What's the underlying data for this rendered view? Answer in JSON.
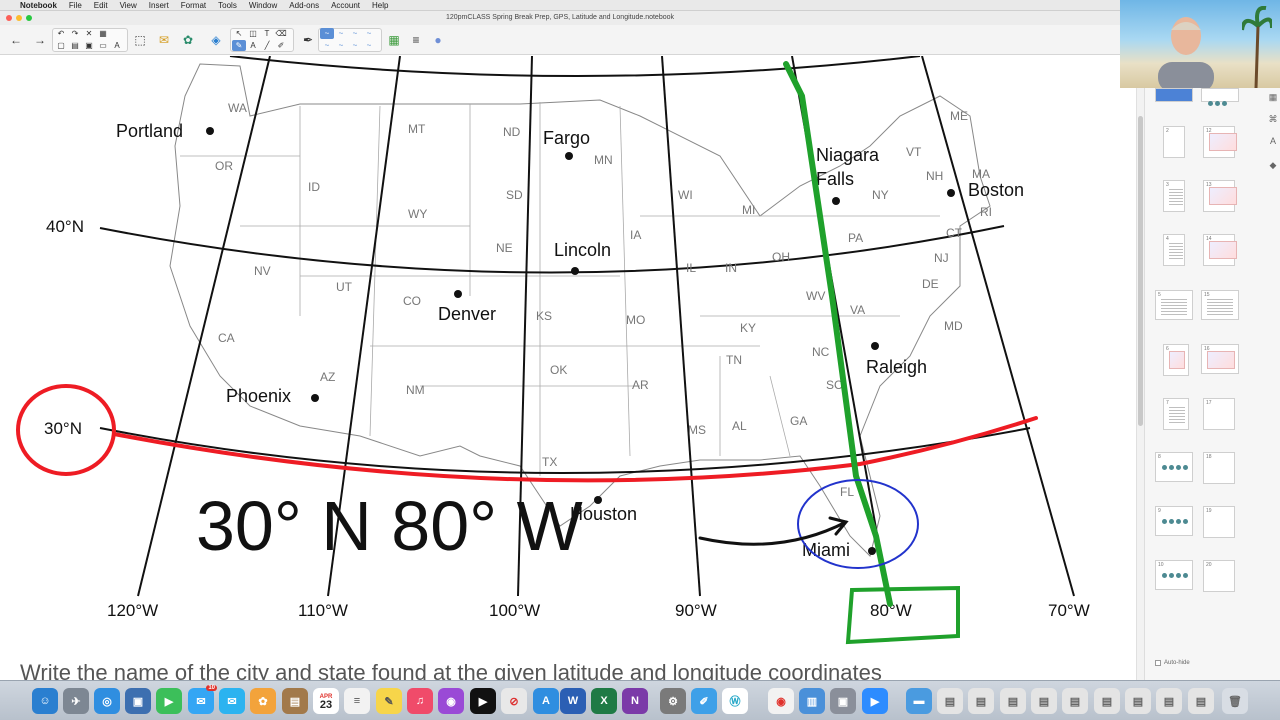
{
  "menubar": {
    "app_name": "Notebook",
    "items": [
      "File",
      "Edit",
      "View",
      "Insert",
      "Format",
      "Tools",
      "Window",
      "Add-ons",
      "Account",
      "Help"
    ]
  },
  "window": {
    "title": "120pmCLASS Spring Break Prep, GPS, Latitude and Longitude.notebook"
  },
  "map": {
    "lat_labels": [
      "40°N",
      "30°N"
    ],
    "lon_labels": [
      "120°W",
      "110°W",
      "100°W",
      "90°W",
      "80°W",
      "70°W"
    ],
    "cities": [
      "Portland",
      "Fargo",
      "Niagara",
      "Falls",
      "Boston",
      "Lincoln",
      "Denver",
      "Raleigh",
      "Phoenix",
      "Houston",
      "Miami"
    ],
    "states": [
      "WA",
      "OR",
      "ID",
      "MT",
      "ND",
      "MN",
      "WY",
      "SD",
      "WI",
      "MI",
      "NY",
      "VT",
      "NH",
      "ME",
      "MA",
      "RI",
      "CT",
      "NE",
      "IA",
      "IL",
      "IN",
      "OH",
      "PA",
      "NJ",
      "NV",
      "UT",
      "CO",
      "KS",
      "MO",
      "KY",
      "WV",
      "VA",
      "DE",
      "MD",
      "CA",
      "AZ",
      "NM",
      "OK",
      "AR",
      "TN",
      "NC",
      "SC",
      "MS",
      "AL",
      "GA",
      "TX",
      "FL"
    ],
    "handwriting": "30° N 80° W",
    "bottom_text": "Write the name of the city and state found at the given latitude and longitude coordinates"
  },
  "sidebar": {
    "page_numbers": [
      "2",
      "12",
      "3",
      "13",
      "4",
      "14",
      "5",
      "15",
      "6",
      "16",
      "7",
      "17",
      "8",
      "18",
      "9",
      "19",
      "10",
      "20"
    ],
    "autohide_label": "Auto-hide"
  },
  "dock": {
    "calendar_month": "APR",
    "calendar_day": "23",
    "messages_badge": "10"
  },
  "colors": {
    "red_annotation": "#ee1c24",
    "green_annotation": "#1fa12b",
    "blue_annotation": "#2233cc"
  }
}
